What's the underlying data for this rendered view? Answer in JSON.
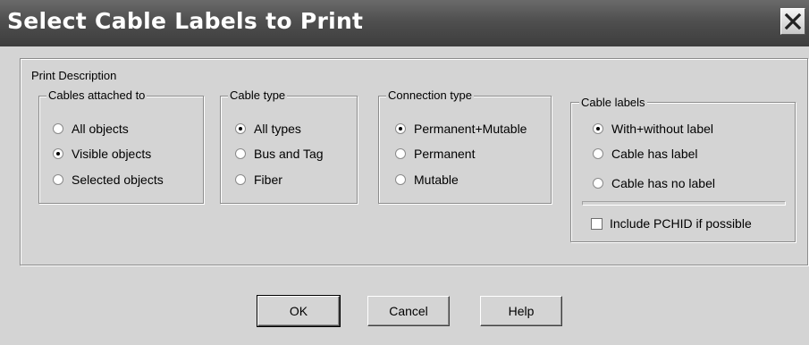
{
  "window": {
    "title": "Select Cable Labels to Print"
  },
  "print_description": {
    "label": "Print Description",
    "cables_attached_to": {
      "label": "Cables attached to",
      "options": [
        "All objects",
        "Visible objects",
        "Selected objects"
      ],
      "selected": 1
    },
    "cable_type": {
      "label": "Cable type",
      "options": [
        "All types",
        "Bus and Tag",
        "Fiber"
      ],
      "selected": 0
    },
    "connection_type": {
      "label": "Connection type",
      "options": [
        "Permanent+Mutable",
        "Permanent",
        "Mutable"
      ],
      "selected": 0
    },
    "cable_labels": {
      "label": "Cable labels",
      "options": [
        "With+without label",
        "Cable has label",
        "Cable has no label"
      ],
      "selected": 0,
      "include_pchid": {
        "label": "Include PCHID if possible",
        "checked": false
      }
    }
  },
  "buttons": {
    "ok": "OK",
    "cancel": "Cancel",
    "help": "Help"
  }
}
